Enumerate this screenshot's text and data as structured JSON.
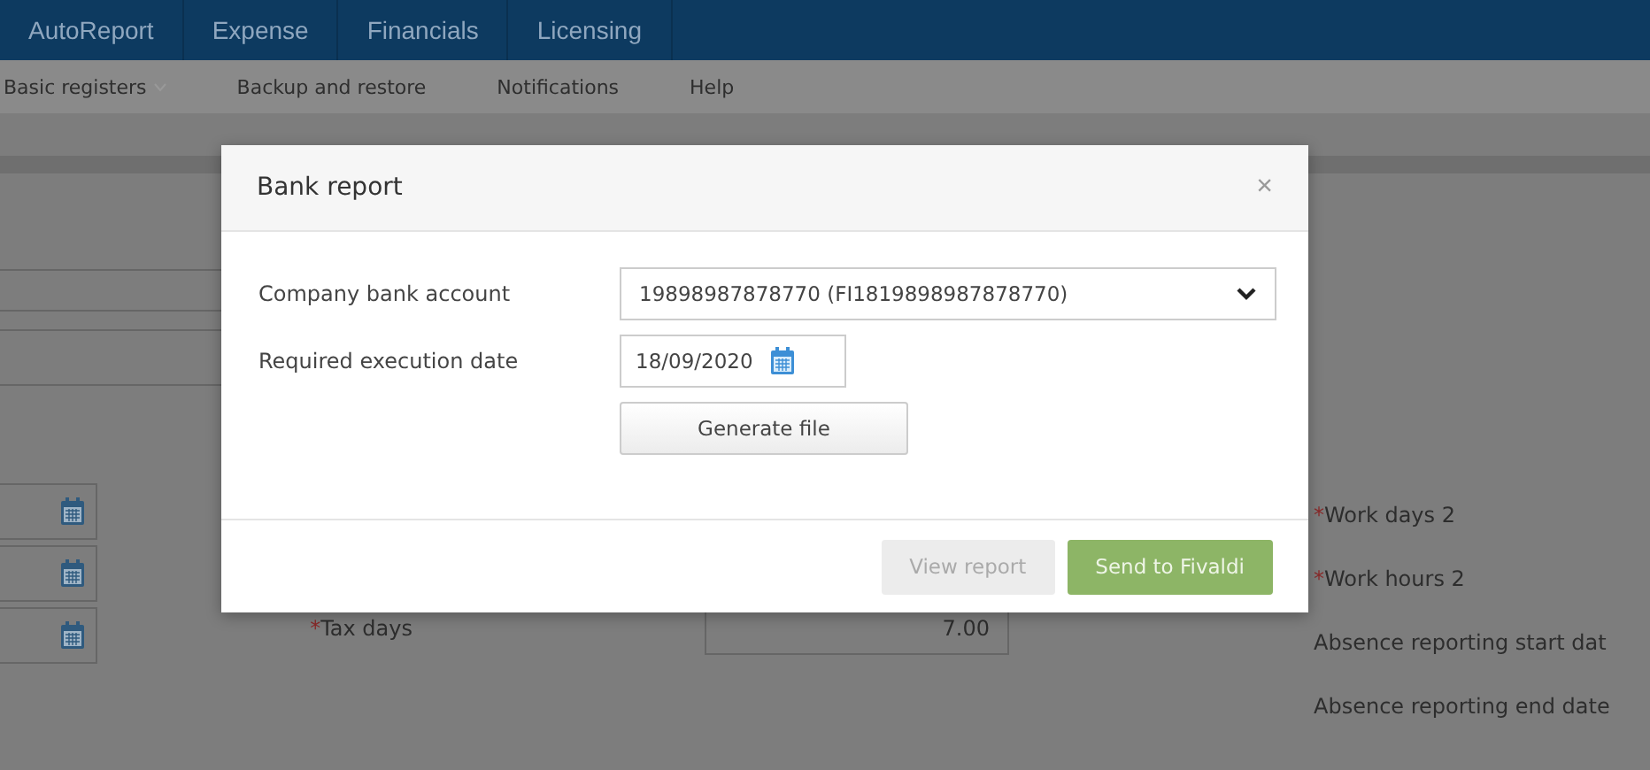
{
  "nav": {
    "tabs": [
      "AutoReport",
      "Expense",
      "Financials",
      "Licensing"
    ]
  },
  "subnav": {
    "items": [
      {
        "label": "Basic registers",
        "has_caret": true
      },
      {
        "label": "Backup and restore",
        "has_caret": false
      },
      {
        "label": "Notifications",
        "has_caret": false
      },
      {
        "label": "Help",
        "has_caret": false
      }
    ]
  },
  "form": {
    "tax_days": {
      "marker": "*",
      "label": "Tax days",
      "value": "7.00"
    },
    "right_labels": [
      {
        "marker": "*",
        "label": "Work days 2"
      },
      {
        "marker": "*",
        "label": "Work hours 2"
      },
      {
        "label": "Absence reporting start dat"
      },
      {
        "label": "Absence reporting end date"
      }
    ]
  },
  "dialog": {
    "title": "Bank report",
    "close": "×",
    "fields": [
      {
        "kind": "select",
        "label": "Company bank account",
        "value": "19898987878770 (FI1819898987878770)"
      },
      {
        "kind": "date",
        "label": "Required execution date",
        "value": "18/09/2020"
      }
    ],
    "generate_button": "Generate file",
    "buttons": [
      {
        "label": "View report",
        "disabled": true,
        "primary": false
      },
      {
        "label": "Send to Fivaldi",
        "disabled": false,
        "primary": true
      }
    ]
  }
}
